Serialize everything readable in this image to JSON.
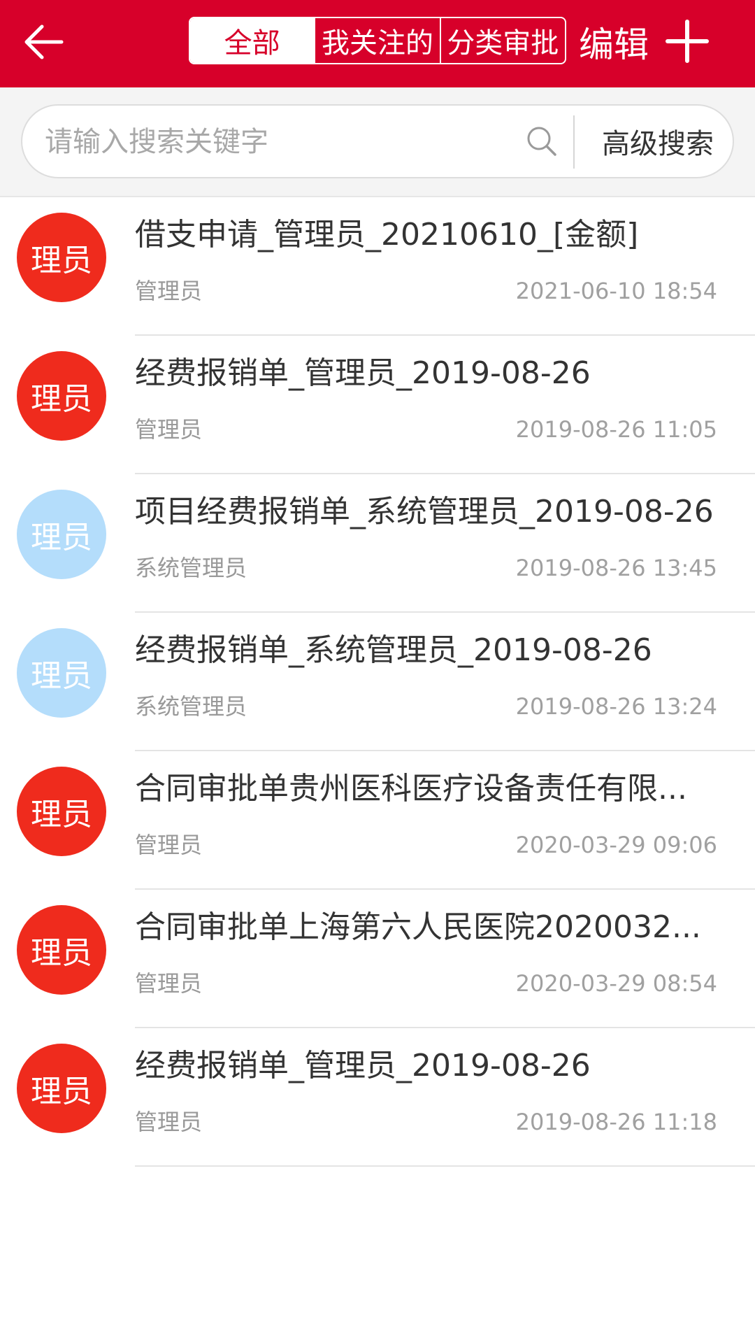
{
  "header": {
    "tabs": [
      {
        "label": "全部",
        "active": true
      },
      {
        "label": "我关注的",
        "active": false
      },
      {
        "label": "分类审批",
        "active": false
      }
    ],
    "edit_label": "编辑",
    "colors": {
      "brand": "#d7002a"
    }
  },
  "search": {
    "placeholder": "请输入搜索关键字",
    "value": "",
    "advanced_label": "高级搜索"
  },
  "colors": {
    "avatar_red": "#ef2b1d",
    "avatar_blue": "#b4ddfb"
  },
  "items": [
    {
      "avatar": "理员",
      "avatar_color": "red",
      "title": "借支申请_管理员_20210610_[金额]",
      "author": "管理员",
      "time": "2021-06-10 18:54"
    },
    {
      "avatar": "理员",
      "avatar_color": "red",
      "title": "经费报销单_管理员_2019-08-26",
      "author": "管理员",
      "time": "2019-08-26 11:05"
    },
    {
      "avatar": "理员",
      "avatar_color": "blue",
      "title": "项目经费报销单_系统管理员_2019-08-26",
      "author": "系统管理员",
      "time": "2019-08-26 13:45"
    },
    {
      "avatar": "理员",
      "avatar_color": "blue",
      "title": "经费报销单_系统管理员_2019-08-26",
      "author": "系统管理员",
      "time": "2019-08-26 13:24"
    },
    {
      "avatar": "理员",
      "avatar_color": "red",
      "title": "合同审批单贵州医科医疗设备责任有限...",
      "author": "管理员",
      "time": "2020-03-29 09:06"
    },
    {
      "avatar": "理员",
      "avatar_color": "red",
      "title": "合同审批单上海第六人民医院2020032...",
      "author": "管理员",
      "time": "2020-03-29 08:54"
    },
    {
      "avatar": "理员",
      "avatar_color": "red",
      "title": "经费报销单_管理员_2019-08-26",
      "author": "管理员",
      "time": "2019-08-26 11:18"
    }
  ]
}
